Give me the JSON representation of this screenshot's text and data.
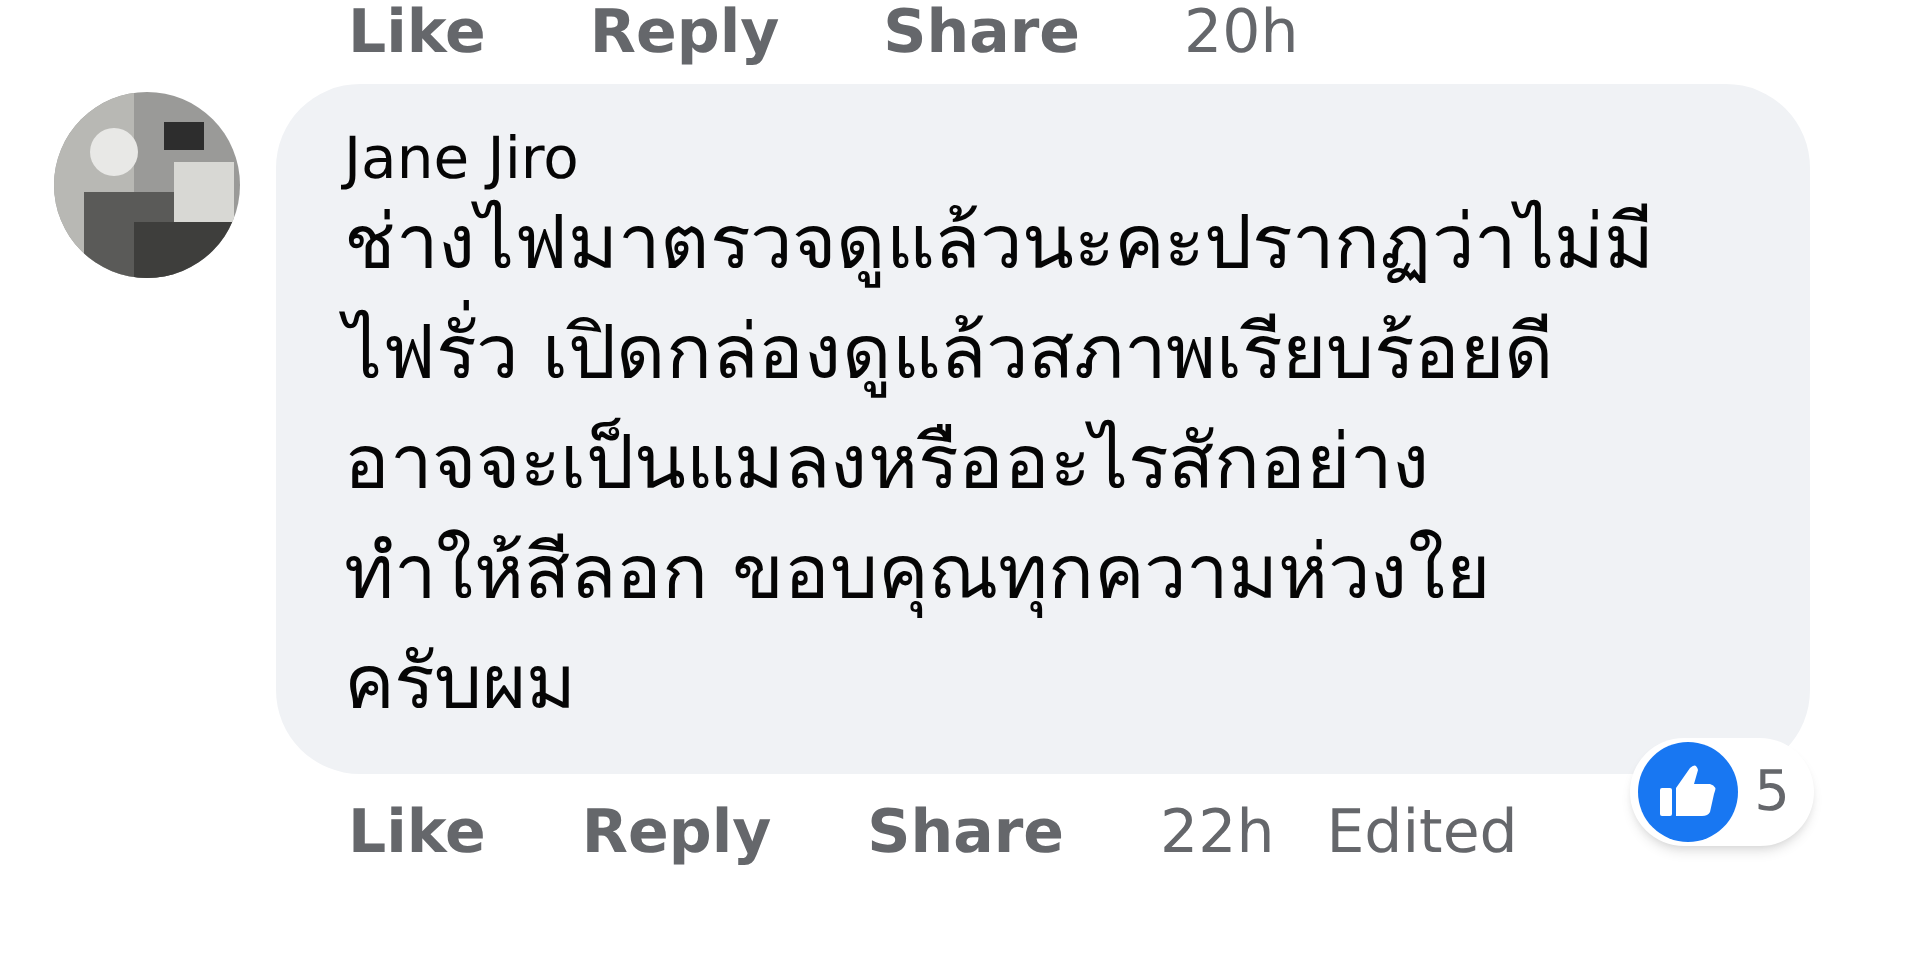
{
  "previous_actions": {
    "like": "Like",
    "reply": "Reply",
    "share": "Share",
    "time": "20h"
  },
  "comment": {
    "author": "Jane Jiro",
    "text": "ช่างไฟมาตรวจดูแล้วนะคะปรากฏว่าไม่มี\nไฟรั่ว เปิดกล่องดูแล้วสภาพเรียบร้อยดี\nอาจจะเป็นแมลงหรืออะไรสักอย่าง\nทำให้สีลอก ขอบคุณทุกความห่วงใย\nครับผม",
    "reaction_count": "5",
    "actions": {
      "like": "Like",
      "reply": "Reply",
      "share": "Share",
      "time": "22h",
      "edited": "Edited"
    }
  }
}
